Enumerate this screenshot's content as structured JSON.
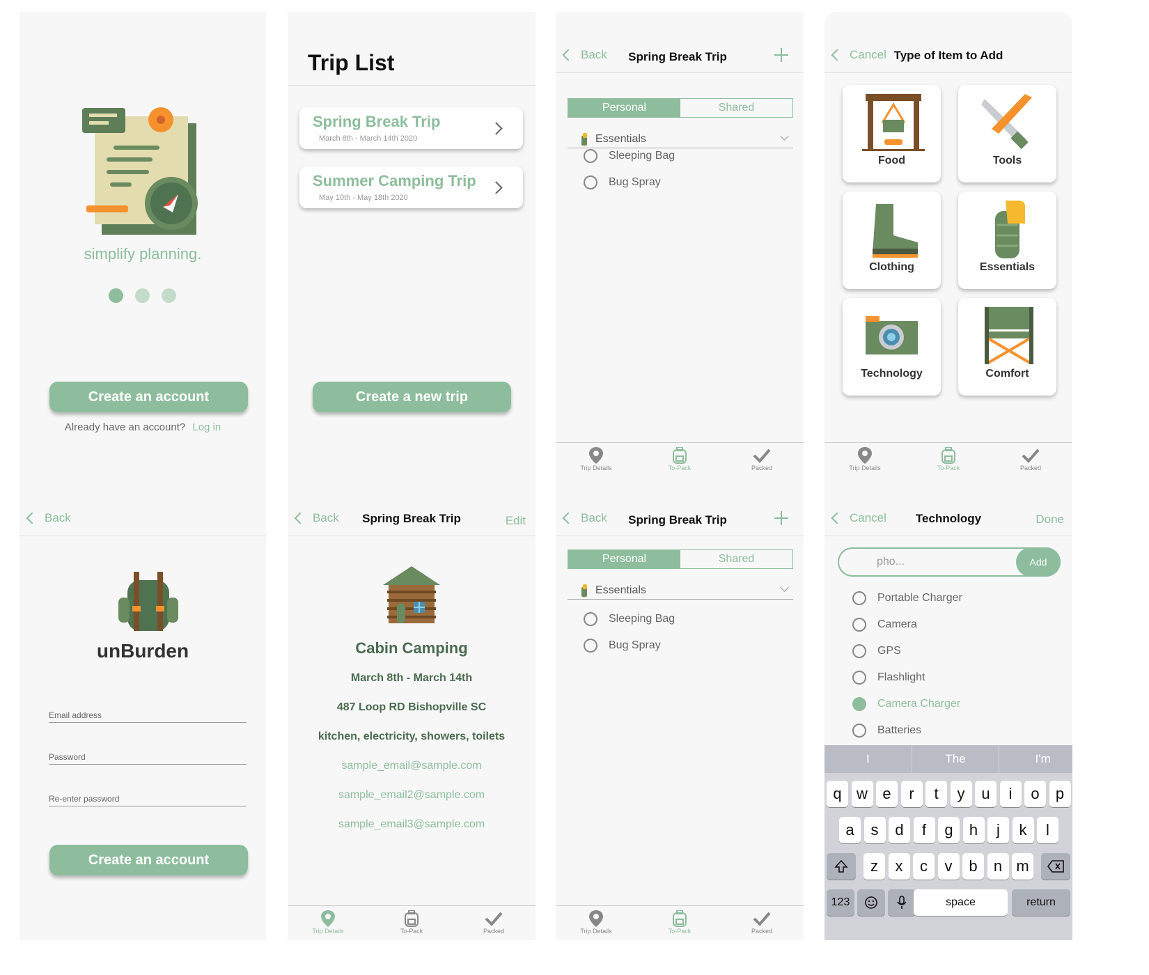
{
  "welcome": {
    "tagline": "simplify planning.",
    "create_button": "Create an account",
    "login_prompt": "Already have an account?",
    "login_link": "Log in"
  },
  "trip_list": {
    "title": "Trip List",
    "trips": [
      {
        "name": "Spring Break Trip",
        "dates": "March 8th - March 14th 2020"
      },
      {
        "name": "Summer Camping Trip",
        "dates": "May 10th - May 18th 2020"
      }
    ],
    "create_button": "Create a new trip"
  },
  "packing": {
    "back": "Back",
    "title": "Spring Break Trip",
    "seg_personal": "Personal",
    "seg_shared": "Shared",
    "section": "Essentials",
    "items": [
      "Sleeping Bag",
      "Bug Spray"
    ]
  },
  "type_picker": {
    "cancel": "Cancel",
    "title": "Type of Item to Add",
    "types": [
      "Food",
      "Tools",
      "Clothing",
      "Essentials",
      "Technology",
      "Comfort"
    ]
  },
  "tabbar": {
    "trip_details": "Trip Details",
    "to_pack": "To-Pack",
    "packed": "Packed"
  },
  "signup": {
    "back": "Back",
    "app_name": "unBurden",
    "email_label": "Email address",
    "password_label": "Password",
    "reenter_label": "Re-enter password",
    "create_button": "Create an account"
  },
  "trip_details": {
    "back": "Back",
    "title": "Spring Break Trip",
    "edit": "Edit",
    "place": "Cabin Camping",
    "dates": "March 8th - March 14th",
    "address": "487 Loop RD Bishopville SC",
    "amenities": "kitchen,  electricity, showers, toilets",
    "emails": [
      "sample_email@sample.com",
      "sample_email2@sample.com",
      "sample_email3@sample.com"
    ]
  },
  "tech": {
    "cancel": "Cancel",
    "title": "Technology",
    "done": "Done",
    "search_value": "pho...",
    "add": "Add",
    "items": [
      {
        "label": "Portable Charger",
        "checked": false
      },
      {
        "label": "Camera",
        "checked": false
      },
      {
        "label": "GPS",
        "checked": false
      },
      {
        "label": "Flashlight",
        "checked": false
      },
      {
        "label": "Camera Charger",
        "checked": true
      },
      {
        "label": "Batteries",
        "checked": false
      }
    ],
    "suggestions": [
      "I",
      "The",
      "I'm"
    ],
    "row1": [
      "q",
      "w",
      "e",
      "r",
      "t",
      "y",
      "u",
      "i",
      "o",
      "p"
    ],
    "row2": [
      "a",
      "s",
      "d",
      "f",
      "g",
      "h",
      "j",
      "k",
      "l"
    ],
    "row3": [
      "z",
      "x",
      "c",
      "v",
      "b",
      "n",
      "m"
    ],
    "key_123": "123",
    "key_space": "space",
    "key_return": "return"
  },
  "colors": {
    "accent": "#8dbd9c",
    "dark_green": "#4a6b4f",
    "orange": "#f5922e"
  }
}
